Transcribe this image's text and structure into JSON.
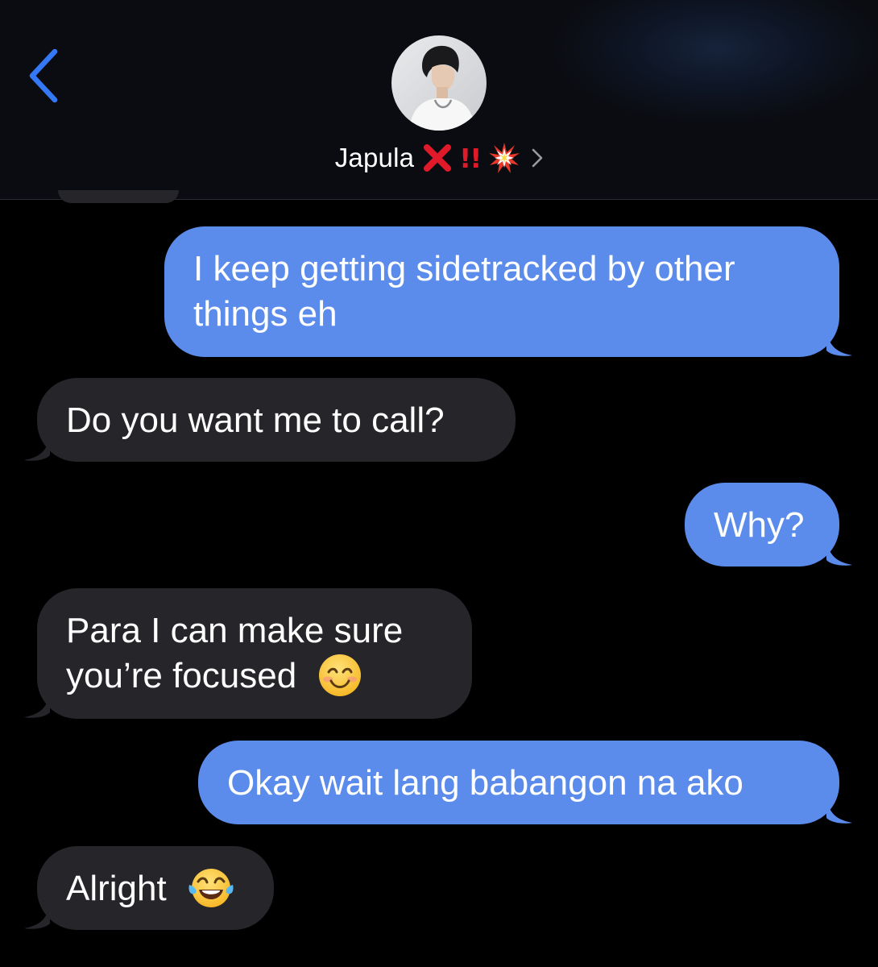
{
  "header": {
    "contact_name": "Japula",
    "decorations": [
      "cross-mark-emoji",
      "double-exclamation-emoji",
      "collision-emoji"
    ],
    "bang_text": "!!"
  },
  "messages": [
    {
      "direction": "out",
      "text": "I keep getting sidetracked by other things eh"
    },
    {
      "direction": "in",
      "text": "Do you want me to call?"
    },
    {
      "direction": "out",
      "text": "Why?"
    },
    {
      "direction": "in",
      "text": "Para I can make sure you’re focused",
      "emoji": "smiling-face-emoji"
    },
    {
      "direction": "out",
      "text": "Okay wait lang babangon na ako"
    },
    {
      "direction": "in",
      "text": "Alright",
      "emoji": "tears-of-joy-emoji"
    }
  ],
  "colors": {
    "outgoing_bubble": "#5b8ceb",
    "incoming_bubble": "#26252a",
    "back_accent": "#3478f6",
    "background": "#000000"
  }
}
